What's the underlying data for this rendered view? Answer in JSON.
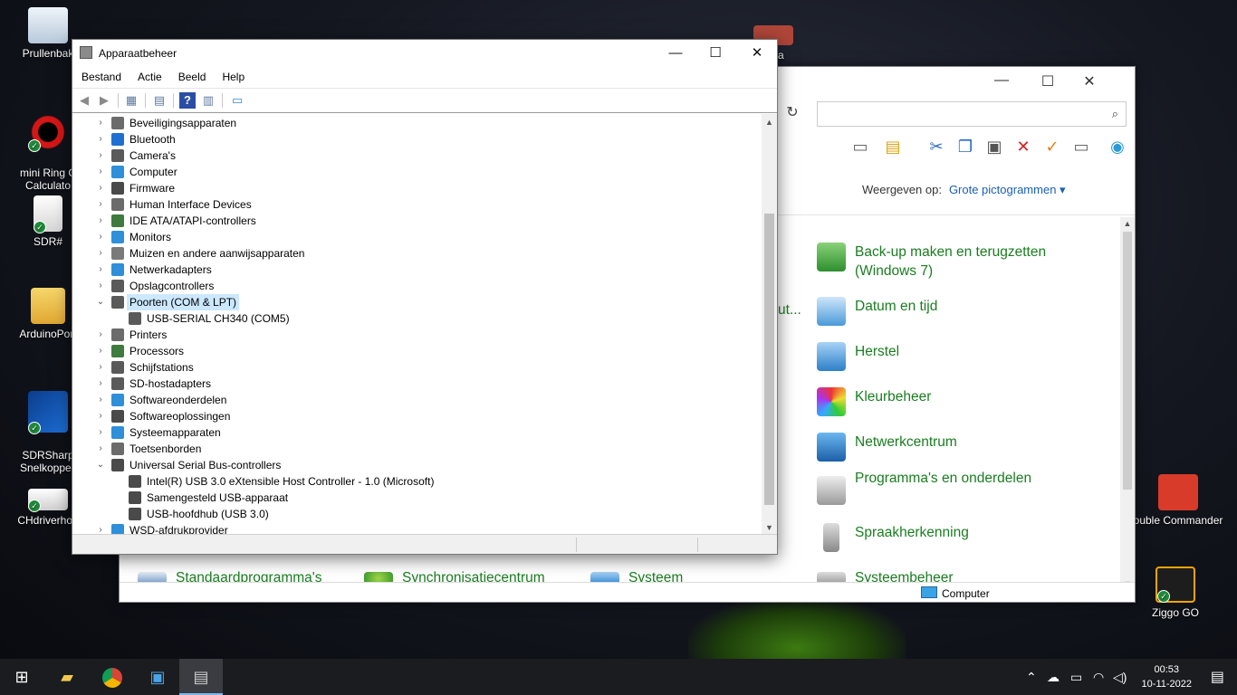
{
  "desktop": {
    "icons": [
      {
        "label": "Prullenbak"
      },
      {
        "label": "mini Ring C\nCalculato"
      },
      {
        "label": "SDR#"
      },
      {
        "label": "ArduinoPort"
      },
      {
        "label": "SDRSharp\nSnelkoppeli"
      },
      {
        "label": "CHdriverhoe"
      },
      {
        "label": "tmega"
      },
      {
        "label": "ouble Commander"
      },
      {
        "label": "Ziggo GO"
      }
    ]
  },
  "control_panel": {
    "view_label": "Weergeven op:",
    "view_value": "Grote pictogrammen",
    "truncated_item": "ut...",
    "items": [
      {
        "label": "Back-up maken en terugzetten (Windows 7)",
        "icon": "backup-icon"
      },
      {
        "label": "Datum en tijd",
        "icon": "calendar-clock-icon"
      },
      {
        "label": "Herstel",
        "icon": "recovery-icon"
      },
      {
        "label": "Kleurbeheer",
        "icon": "color-management-icon"
      },
      {
        "label": "Netwerkcentrum",
        "icon": "network-center-icon"
      },
      {
        "label": "Programma's en onderdelen",
        "icon": "programs-icon"
      },
      {
        "label": "Spraakherkenning",
        "icon": "microphone-icon"
      },
      {
        "label": "Systeembeheer",
        "icon": "admin-tools-icon"
      }
    ],
    "bottom_items": [
      {
        "label": "Standaardprogramma's"
      },
      {
        "label": "Synchronisatiecentrum"
      },
      {
        "label": "Systeem"
      }
    ],
    "status": "Computer"
  },
  "device_manager": {
    "title": "Apparaatbeheer",
    "menu": [
      "Bestand",
      "Actie",
      "Beeld",
      "Help"
    ],
    "tree": [
      {
        "label": "Beveiligingsapparaten",
        "level": 0,
        "expanded": false,
        "icon": "security-device-icon",
        "color": "#6b6b6b"
      },
      {
        "label": "Bluetooth",
        "level": 0,
        "expanded": false,
        "icon": "bluetooth-icon",
        "color": "#1f6fd1"
      },
      {
        "label": "Camera's",
        "level": 0,
        "expanded": false,
        "icon": "camera-icon",
        "color": "#5a5a5a"
      },
      {
        "label": "Computer",
        "level": 0,
        "expanded": false,
        "icon": "computer-icon",
        "color": "#2f8fd8"
      },
      {
        "label": "Firmware",
        "level": 0,
        "expanded": false,
        "icon": "firmware-icon",
        "color": "#4a4a4a"
      },
      {
        "label": "Human Interface Devices",
        "level": 0,
        "expanded": false,
        "icon": "hid-icon",
        "color": "#6b6b6b"
      },
      {
        "label": "IDE ATA/ATAPI-controllers",
        "level": 0,
        "expanded": false,
        "icon": "ide-controller-icon",
        "color": "#3f7a3f"
      },
      {
        "label": "Monitors",
        "level": 0,
        "expanded": false,
        "icon": "monitor-icon",
        "color": "#2f8fd8"
      },
      {
        "label": "Muizen en andere aanwijsapparaten",
        "level": 0,
        "expanded": false,
        "icon": "mouse-icon",
        "color": "#7a7a7a"
      },
      {
        "label": "Netwerkadapters",
        "level": 0,
        "expanded": false,
        "icon": "network-adapter-icon",
        "color": "#2f8fd8"
      },
      {
        "label": "Opslagcontrollers",
        "level": 0,
        "expanded": false,
        "icon": "storage-controller-icon",
        "color": "#5a5a5a"
      },
      {
        "label": "Poorten (COM & LPT)",
        "level": 0,
        "expanded": true,
        "selected": true,
        "icon": "port-icon",
        "color": "#5a5a5a"
      },
      {
        "label": "USB-SERIAL CH340 (COM5)",
        "level": 1,
        "icon": "port-device-icon",
        "color": "#5a5a5a"
      },
      {
        "label": "Printers",
        "level": 0,
        "expanded": false,
        "icon": "printer-icon",
        "color": "#6b6b6b"
      },
      {
        "label": "Processors",
        "level": 0,
        "expanded": false,
        "icon": "processor-icon",
        "color": "#3f7a3f"
      },
      {
        "label": "Schijfstations",
        "level": 0,
        "expanded": false,
        "icon": "disk-drive-icon",
        "color": "#5a5a5a"
      },
      {
        "label": "SD-hostadapters",
        "level": 0,
        "expanded": false,
        "icon": "sd-host-icon",
        "color": "#5a5a5a"
      },
      {
        "label": "Softwareonderdelen",
        "level": 0,
        "expanded": false,
        "icon": "software-component-icon",
        "color": "#2f8fd8"
      },
      {
        "label": "Softwareoplossingen",
        "level": 0,
        "expanded": false,
        "icon": "software-device-icon",
        "color": "#4a4a4a"
      },
      {
        "label": "Systeemapparaten",
        "level": 0,
        "expanded": false,
        "icon": "system-device-icon",
        "color": "#2f8fd8"
      },
      {
        "label": "Toetsenborden",
        "level": 0,
        "expanded": false,
        "icon": "keyboard-icon",
        "color": "#6b6b6b"
      },
      {
        "label": "Universal Serial Bus-controllers",
        "level": 0,
        "expanded": true,
        "icon": "usb-icon",
        "color": "#4a4a4a"
      },
      {
        "label": "Intel(R) USB 3.0 eXtensible Host Controller - 1.0 (Microsoft)",
        "level": 1,
        "icon": "usb-device-icon",
        "color": "#4a4a4a"
      },
      {
        "label": "Samengesteld USB-apparaat",
        "level": 1,
        "icon": "usb-device-icon",
        "color": "#4a4a4a"
      },
      {
        "label": "USB-hoofdhub (USB 3.0)",
        "level": 1,
        "icon": "usb-device-icon",
        "color": "#4a4a4a"
      },
      {
        "label": "WSD-afdrukprovider",
        "level": 0,
        "expanded": false,
        "icon": "wsd-print-icon",
        "color": "#2f8fd8"
      }
    ]
  },
  "taskbar": {
    "time": "00:53",
    "date": "10-11-2022"
  }
}
